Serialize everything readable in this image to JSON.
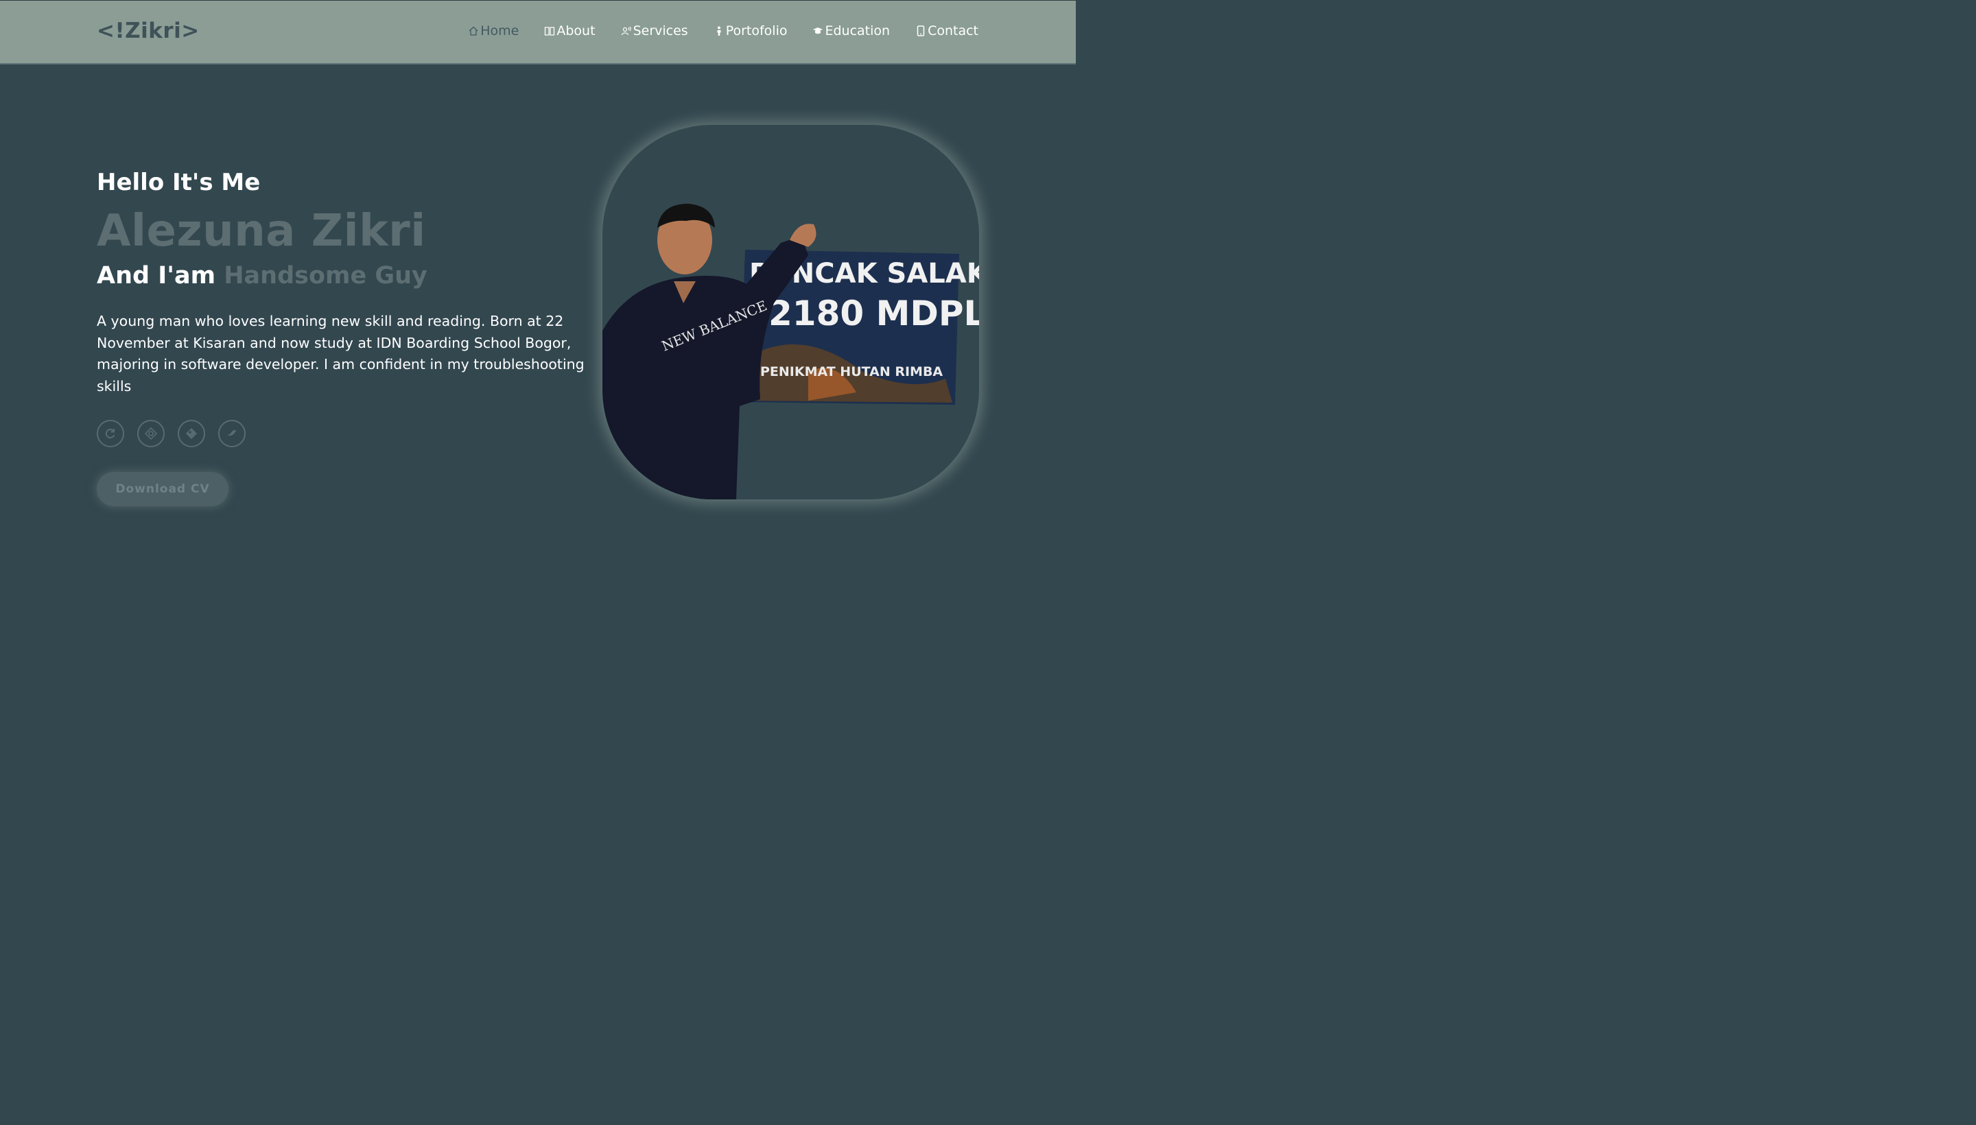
{
  "header": {
    "logo": "<!Zikri>",
    "nav": [
      {
        "label": "Home",
        "icon": "home-icon",
        "active": true
      },
      {
        "label": "About",
        "icon": "book-icon",
        "active": false
      },
      {
        "label": "Services",
        "icon": "person-voice-icon",
        "active": false
      },
      {
        "label": "Portofolio",
        "icon": "person-icon",
        "active": false
      },
      {
        "label": "Education",
        "icon": "graduation-cap-icon",
        "active": false
      },
      {
        "label": "Contact",
        "icon": "phone-icon",
        "active": false
      }
    ]
  },
  "hero": {
    "greeting": "Hello It's Me",
    "name": "Alezuna Zikri",
    "iam_prefix": "And I'am",
    "iam_role": "Handsome Guy",
    "description": "A young man who loves learning new skill and reading. Born at 22 November at Kisaran and now study at IDN Boarding School Bogor, majoring in software developer. I am confident in my troubleshooting skills",
    "socials": [
      "refresh-icon",
      "target-icon",
      "tag-icon",
      "bird-icon"
    ],
    "cta": "Download CV"
  },
  "photo": {
    "sign_line1": "PUNCAK SALAK II",
    "sign_line2": "2180 MDPL",
    "sign_line3": "PENIKMAT HUTAN RIMBA",
    "shirt_text": "NEW BALANCE"
  },
  "colors": {
    "background": "#33474f",
    "header": "#8b9d95",
    "muted_text": "#5d6e72"
  }
}
